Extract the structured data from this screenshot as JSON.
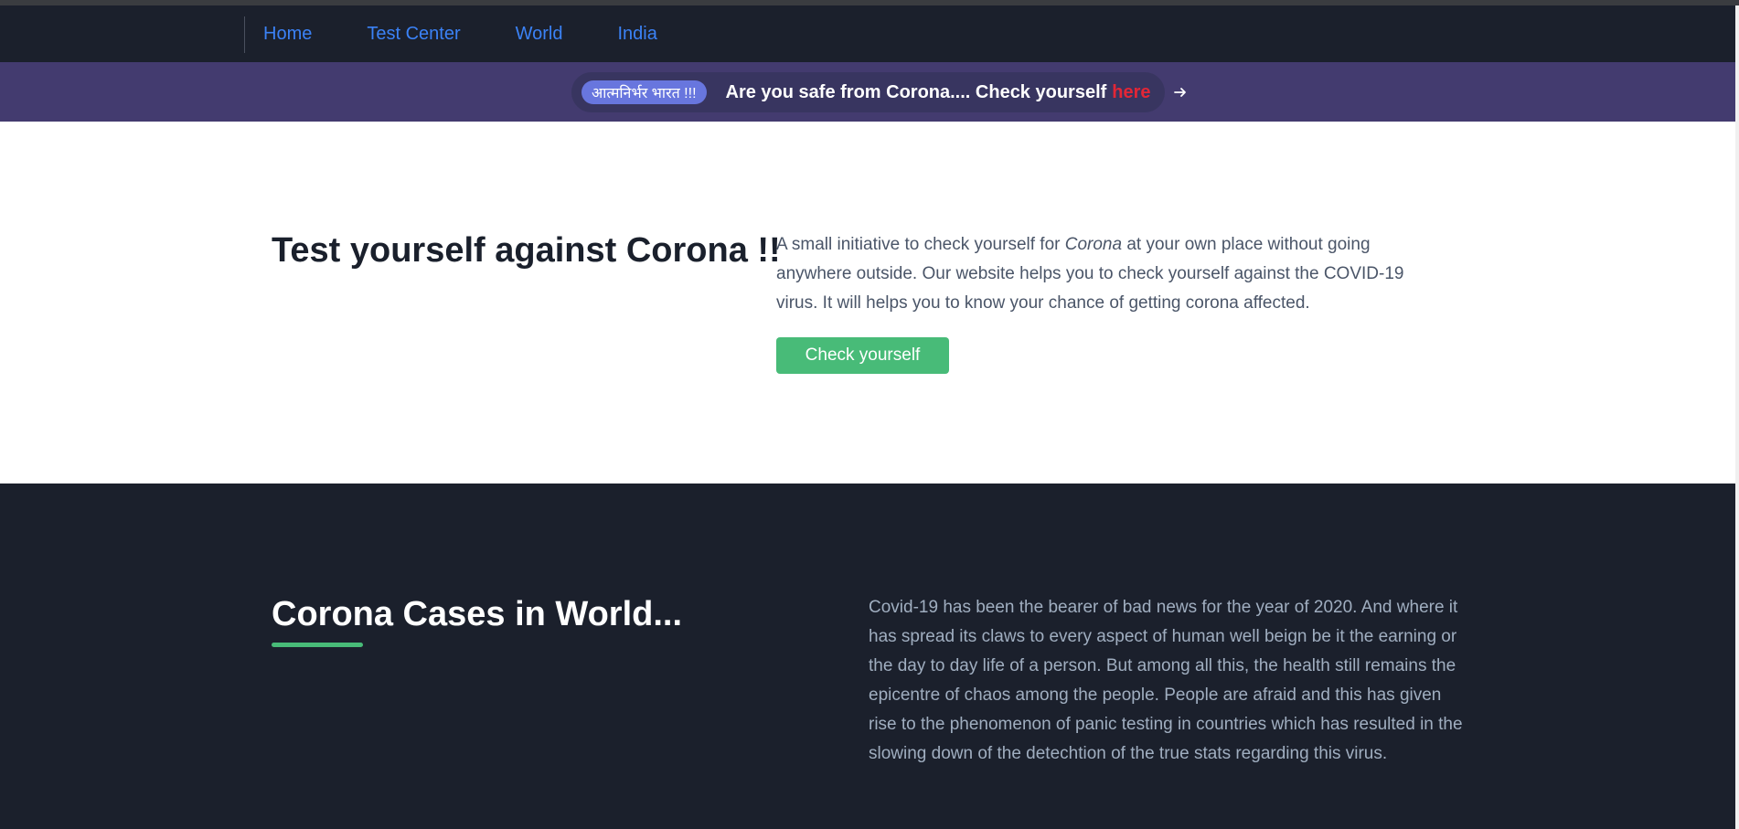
{
  "nav": {
    "links": [
      "Home",
      "Test Center",
      "World",
      "India"
    ]
  },
  "banner": {
    "badge": "आत्मनिर्भर भारत !!!",
    "text": "Are you safe from Corona.... Check yourself",
    "link": "here",
    "arrow_icon": "arrow-right-icon"
  },
  "hero": {
    "title": "Test yourself against Corona !!",
    "desc_before": "A small initiative to check yourself for ",
    "desc_em": "Corona",
    "desc_after": " at your own place without going anywhere outside. Our website helps you to check yourself against the COVID-19 virus. It will helps you to know your chance of getting corona affected.",
    "button": "Check yourself"
  },
  "world": {
    "title": "Corona Cases in World...",
    "desc": "Covid-19 has been the bearer of bad news for the year of 2020. And where it has spread its claws to every aspect of human well beign be it the earning or the day to day life of a person. But among all this, the health still remains the epicentre of chaos among the people. People are afraid and this has given rise to the phenomenon of panic testing in countries which has resulted in the slowing down of the detechtion of the true stats regarding this virus."
  },
  "colors": {
    "nav_bg": "#1b202c",
    "link": "#3b82f6",
    "banner_bg": "#433b6f",
    "badge_bg": "#6876de",
    "accent_green": "#48bb78",
    "banner_link": "#e32636"
  }
}
